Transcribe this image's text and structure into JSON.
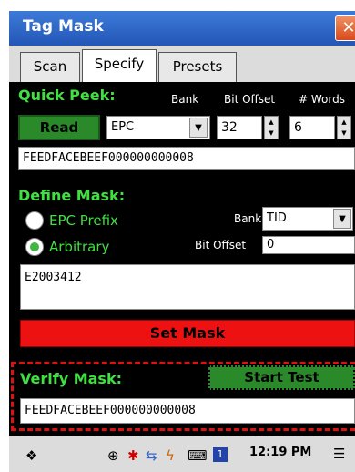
{
  "window": {
    "title": "Tag Mask",
    "close_label": "✕"
  },
  "tabs": [
    {
      "label": "Scan"
    },
    {
      "label": "Specify"
    },
    {
      "label": "Presets"
    }
  ],
  "quick_peek": {
    "heading": "Quick Peek:",
    "bank_label": "Bank",
    "bit_offset_label": "Bit Offset",
    "words_label": "# Words",
    "read_button": "Read",
    "bank_value": "EPC",
    "bit_offset_value": "32",
    "words_value": "6",
    "result": "FEEDFACEBEEF000000000008"
  },
  "define_mask": {
    "heading": "Define Mask:",
    "options": [
      {
        "label": "EPC Prefix",
        "selected": false
      },
      {
        "label": "Arbitrary",
        "selected": true
      }
    ],
    "bank_label": "Bank",
    "bank_value": "TID",
    "bit_offset_label": "Bit Offset",
    "bit_offset_value": "0",
    "mask_value": "E2003412",
    "set_mask_button": "Set Mask"
  },
  "verify_mask": {
    "heading": "Verify Mask:",
    "start_button": "Start Test",
    "result": "FEEDFACEBEEF000000000008"
  },
  "taskbar": {
    "clock": "12:19 PM",
    "icons": [
      "start-icon",
      "network-icon",
      "bluetooth-icon",
      "sync-icon",
      "power-icon",
      "keyboard-icon",
      "app-icon",
      "menu-icon"
    ]
  },
  "colors": {
    "title_bar": "#2356b6",
    "panel_bg": "#000000",
    "label_green": "#3fe03f",
    "button_green": "#2a8a2a",
    "set_mask_red": "#ee1111",
    "highlight_dash": "#dd1111"
  }
}
